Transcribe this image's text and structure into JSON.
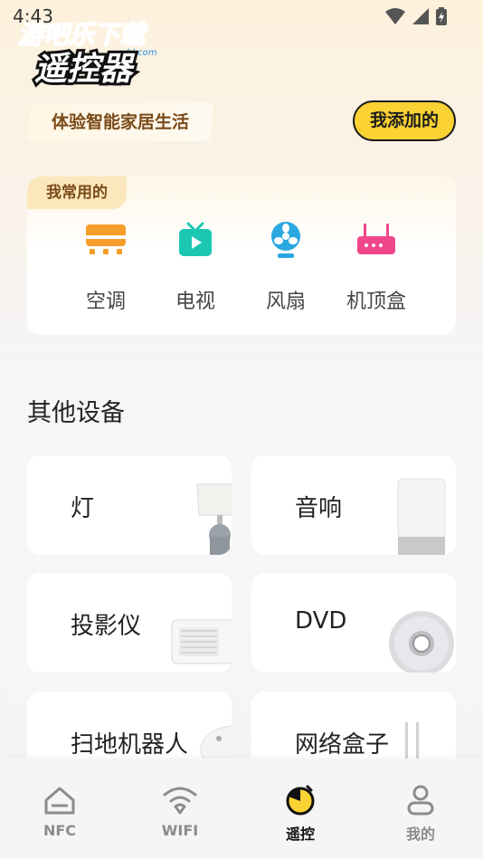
{
  "status_bar": {
    "time": "4:43"
  },
  "logo": {
    "watermark_text": "游吧乐下载",
    "watermark_sub": "yxbl.com",
    "app_name": "遥控器"
  },
  "header": {
    "slogan": "体验智能家居生活",
    "my_added_label": "我添加的"
  },
  "favorites": {
    "tag": "我常用的",
    "items": [
      {
        "label": "空调",
        "icon": "air-conditioner-icon",
        "color": "#f59e2b"
      },
      {
        "label": "电视",
        "icon": "tv-icon",
        "color": "#1cc7b2"
      },
      {
        "label": "风扇",
        "icon": "fan-icon",
        "color": "#2aa8e0"
      },
      {
        "label": "机顶盒",
        "icon": "set-top-box-icon",
        "color": "#f0478a"
      }
    ]
  },
  "other_devices": {
    "title": "其他设备",
    "items": [
      {
        "label": "灯"
      },
      {
        "label": "音响"
      },
      {
        "label": "投影仪"
      },
      {
        "label": "DVD"
      },
      {
        "label": "扫地机器人"
      },
      {
        "label": "网络盒子"
      }
    ]
  },
  "bottom_nav": {
    "items": [
      {
        "label": "NFC",
        "icon": "home-icon"
      },
      {
        "label": "WIFI",
        "icon": "wifi-icon"
      },
      {
        "label": "遥控",
        "icon": "remote-icon",
        "active": true
      },
      {
        "label": "我的",
        "icon": "user-icon"
      }
    ]
  },
  "colors": {
    "accent_yellow": "#fbd233",
    "brand_brown": "#7a4a18"
  }
}
